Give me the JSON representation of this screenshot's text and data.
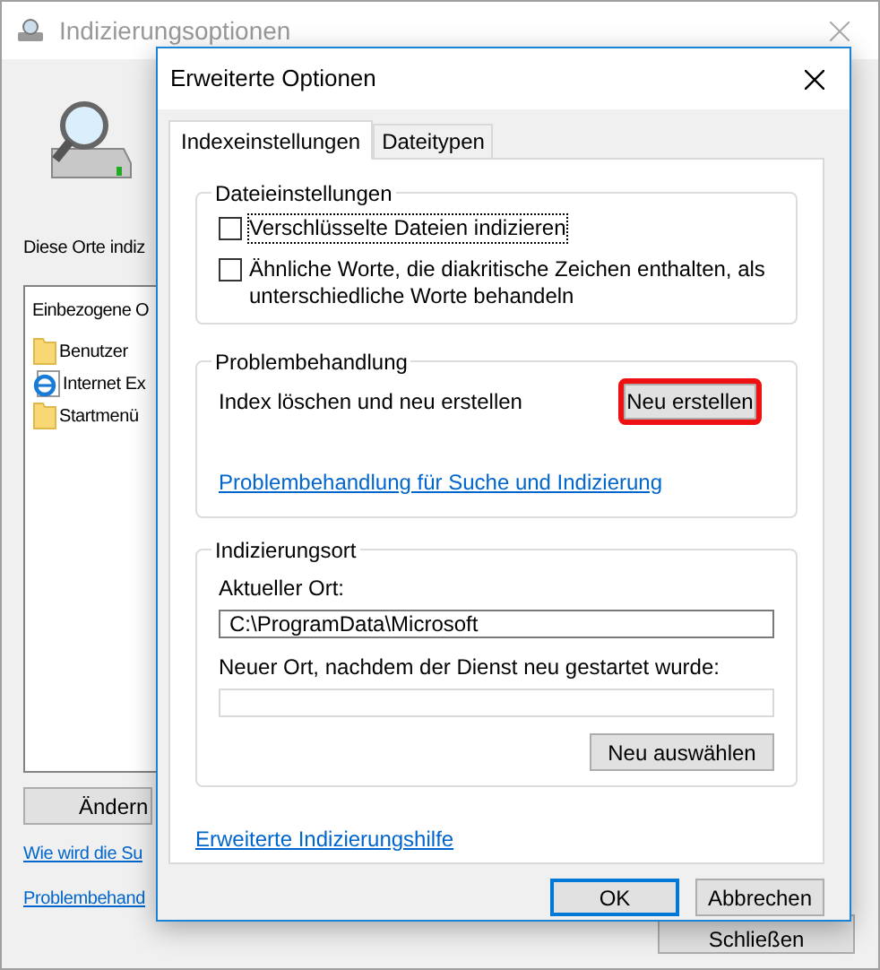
{
  "background_window": {
    "title": "Indizierungsoptionen",
    "intro": "Diese Orte indiz",
    "list": {
      "header": "Einbezogene O",
      "items": [
        {
          "label": "Benutzer",
          "kind": "folder"
        },
        {
          "label": "Internet Ex",
          "kind": "web"
        },
        {
          "label": "Startmenü",
          "kind": "folder"
        }
      ]
    },
    "modify_button": "Ändern",
    "links": [
      "Wie wird die Su",
      "Problembehand"
    ],
    "close_button": "Schließen"
  },
  "dialog": {
    "title": "Erweiterte Optionen",
    "tabs": [
      {
        "label": "Indexeinstellungen",
        "selected": true
      },
      {
        "label": "Dateitypen",
        "selected": false
      }
    ],
    "file_settings": {
      "title": "Dateieinstellungen",
      "options": [
        {
          "label": "Verschlüsselte Dateien indizieren",
          "checked": false,
          "focused": true
        },
        {
          "label": "Ähnliche Worte, die diakritische Zeichen enthalten, als unterschiedliche Worte behandeln",
          "checked": false,
          "focused": false
        }
      ]
    },
    "troubleshooting": {
      "title": "Problembehandlung",
      "text": "Index löschen und neu erstellen",
      "button": {
        "label": "Neu erstellen",
        "highlighted": true
      },
      "link": "Problembehandlung für Suche und Indizierung"
    },
    "location": {
      "title": "Indizierungsort",
      "current_label": "Aktueller Ort:",
      "current_value": "C:\\ProgramData\\Microsoft",
      "new_label": "Neuer Ort, nachdem der Dienst neu gestartet wurde:",
      "select_button": "Neu auswählen"
    },
    "help_link": "Erweiterte Indizierungshilfe",
    "buttons": [
      {
        "label": "OK",
        "default": true
      },
      {
        "label": "Abbrechen",
        "default": false
      }
    ]
  }
}
